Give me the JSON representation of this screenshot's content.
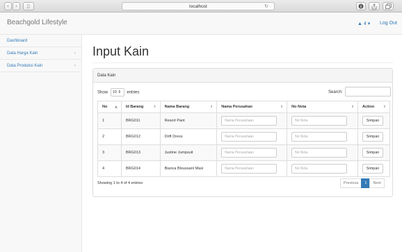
{
  "browser": {
    "url": "localhost",
    "reload_glyph": "↻",
    "back_glyph": "‹",
    "forward_glyph": "›",
    "sidebar_glyph": "▯",
    "icons": [
      "info-icon",
      "share-icon",
      "tabs-icon"
    ]
  },
  "navbar": {
    "brand": "Beachgold Lifestyle",
    "alerts_label": "▲ 4 ▾",
    "logout": "Log Out"
  },
  "sidebar": {
    "items": [
      {
        "label": "Dashboard",
        "arrow": ""
      },
      {
        "label": "Data Harga Kain",
        "arrow": "‹"
      },
      {
        "label": "Data Produksi Kain",
        "arrow": "‹"
      }
    ]
  },
  "page": {
    "title": "Input Kain"
  },
  "panel": {
    "heading": "Data Kain",
    "show_label": "Show",
    "entries_value": "10",
    "entries_label": "entries",
    "search_label": "Search:",
    "columns": [
      "No",
      "Id Barang",
      "Nama Barang",
      "Nama Perusahan",
      "No Nota",
      "Action"
    ],
    "sort_icons": [
      "▲",
      "⇕",
      "⇕",
      "⇕",
      "⇕",
      "⇕"
    ],
    "rows": [
      {
        "no": "1",
        "id": "BRG011",
        "nama": "Resort Pant",
        "perusahaan_placeholder": "Nama Perusahaan",
        "nota_placeholder": "No Nota",
        "action": "Simpan"
      },
      {
        "no": "2",
        "id": "BRG012",
        "nama": "Drift Dress",
        "perusahaan_placeholder": "Nama Perusahaan",
        "nota_placeholder": "No Nota",
        "action": "Simpan"
      },
      {
        "no": "3",
        "id": "BRG013",
        "nama": "Justine Jumpsuit",
        "perusahaan_placeholder": "Nama Perusahaan",
        "nota_placeholder": "No Nota",
        "action": "Simpan"
      },
      {
        "no": "4",
        "id": "BRG014",
        "nama": "Bianca Bloussant Maxi",
        "perusahaan_placeholder": "Nama Perusahaan",
        "nota_placeholder": "No Nota",
        "action": "Simpan"
      }
    ],
    "info": "Showing 1 to 4 of 4 entries",
    "pager": {
      "previous": "Previous",
      "current": "1",
      "next": "Next"
    }
  },
  "colors": {
    "link": "#337ab7",
    "alert": "#d9534f",
    "active_page": "#337ab7"
  }
}
